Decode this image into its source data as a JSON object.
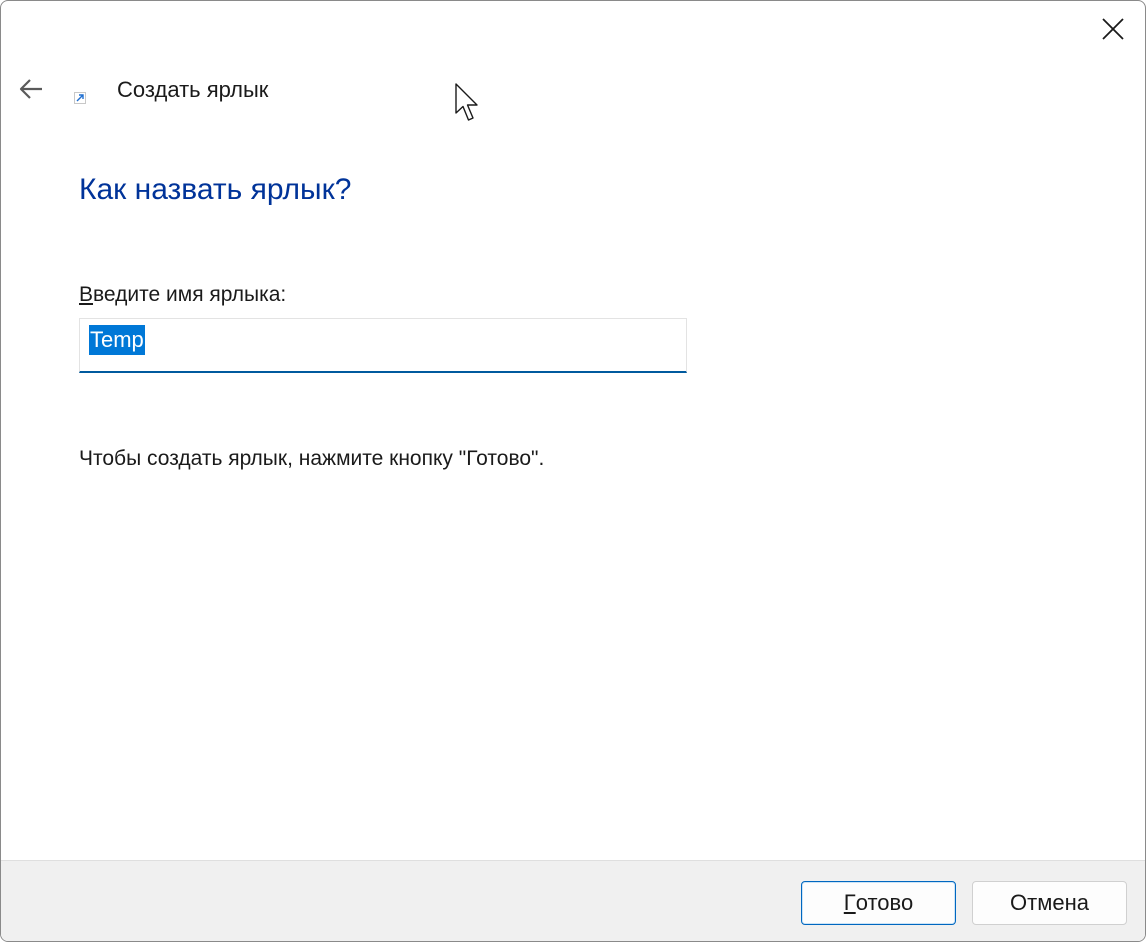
{
  "window": {
    "title": "Создать ярлык"
  },
  "main": {
    "heading": "Как назвать ярлык?",
    "field_label_accel": "В",
    "field_label_rest": "ведите имя ярлыка:",
    "name_value": "Temp",
    "hint": "Чтобы создать ярлык, нажмите кнопку \"Готово\"."
  },
  "footer": {
    "finish_accel": "Г",
    "finish_rest": "отово",
    "cancel_label": "Отмена"
  },
  "colors": {
    "heading": "#003399",
    "selection": "#0078d7",
    "input_underline": "#005a9e",
    "footer_bg": "#f0f0f0"
  },
  "icons": {
    "close": "close-icon",
    "back": "back-arrow-icon",
    "app": "shortcut-icon",
    "cursor": "mouse-pointer-icon"
  }
}
